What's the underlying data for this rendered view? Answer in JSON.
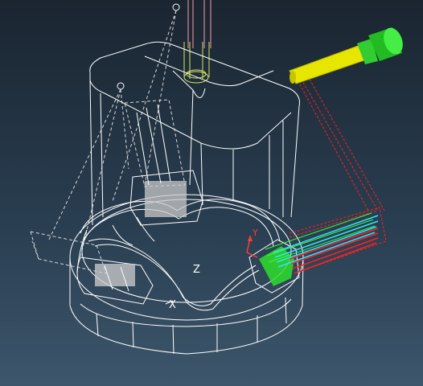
{
  "viewport": {
    "background_top": "#1a2530",
    "background_bottom": "#3d566b"
  },
  "axes": {
    "z_label": "Z",
    "x_label": "X",
    "y_label": "Y"
  },
  "colors": {
    "wireframe": "#ffffff",
    "tool_body": "#e6e600",
    "tool_holder": "#22cc22",
    "toolpath_green": "#33ff33",
    "toolpath_cyan": "#33e0ff",
    "toolpath_red": "#ff2020",
    "axis_y": "#ff3b3b",
    "spindle_pink": "#ff9aa8"
  },
  "icons": {
    "tool": "cutting-tool-icon",
    "triad": "axis-triad-icon"
  }
}
